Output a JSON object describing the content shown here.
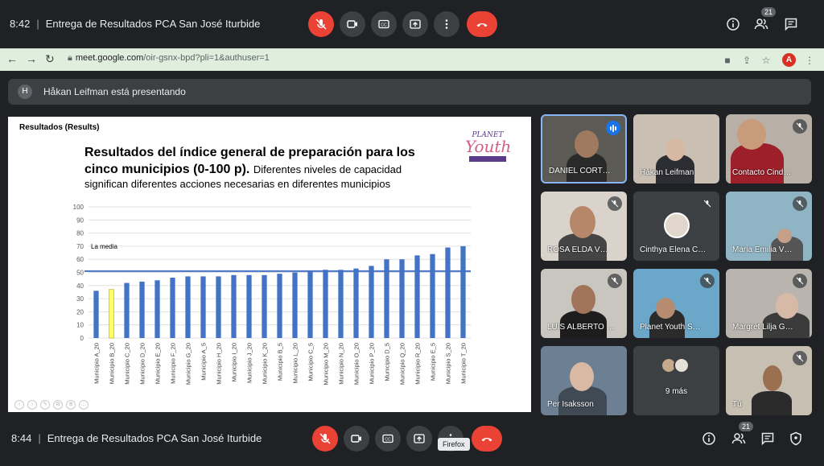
{
  "top_bar": {
    "time": "8:42",
    "separator": "|",
    "meeting_title": "Entrega de Resultados PCA San José Iturbide",
    "participant_count": "21"
  },
  "browser": {
    "url_domain": "meet.google.com",
    "url_path": "/oir-gsnx-bpd?pli=1&authuser=1",
    "profile_initial": "A"
  },
  "banner": {
    "initial": "H",
    "text": "Håkan Leifman está presentando"
  },
  "slide": {
    "label": "Resultados (Results)",
    "title": "Resultados del índice general de preparación para los cinco municipios (0-100 p).",
    "subtitle_inline": "Diferentes niveles de capacidad",
    "subtitle_line2": "significan diferentes acciones necesarias en diferentes municipios",
    "logo_planet": "PLANET",
    "logo_youth": "Youth",
    "mean_label": "La media"
  },
  "chart_data": {
    "type": "bar",
    "categories": [
      "Municipio A_20",
      "Municipio B_20",
      "Municipio C_20",
      "Municipio D_20",
      "Municipio E_20",
      "Municipio F_20",
      "Municipio G_20",
      "Municipio A_5",
      "Municipio H_20",
      "Municipio I_20",
      "Municipio J_20",
      "Municipio K_20",
      "Municipio B_5",
      "Municipio L_20",
      "Municipio C_5",
      "Municipio M_20",
      "Municipio N_20",
      "Municipio O_20",
      "Municipio P_20",
      "Municipio D_5",
      "Municipio Q_20",
      "Municipio R_20",
      "Municipio E_5",
      "Municipio S_20",
      "Municipio T_20"
    ],
    "values": [
      36,
      37,
      42,
      43,
      44,
      46,
      47,
      47,
      47,
      48,
      48,
      48,
      49,
      50,
      51,
      52,
      52,
      53,
      55,
      60,
      60,
      63,
      64,
      69,
      70
    ],
    "highlight_index": 1,
    "mean_value": 51,
    "ylim": [
      0,
      100
    ],
    "yticks": [
      0,
      10,
      20,
      30,
      40,
      50,
      60,
      70,
      80,
      90,
      100
    ],
    "bar_color": "#4472c4",
    "highlight_color": "#ffff66",
    "mean_line_color": "#4472c4"
  },
  "participants": [
    {
      "name": "DANIEL CORT…",
      "speaking": true
    },
    {
      "name": "Håkan Leifman",
      "muted": false
    },
    {
      "name": "Contacto Cind…",
      "muted": true
    },
    {
      "name": "ROSA ELDA V…",
      "muted": true
    },
    {
      "name": "Cinthya Elena C…",
      "muted": true
    },
    {
      "name": "Maria Emilia V…",
      "muted": true
    },
    {
      "name": "LUIS ALBERTO …",
      "muted": true
    },
    {
      "name": "Planet Youth S…",
      "muted": true
    },
    {
      "name": "Margrét Lilja G…",
      "muted": true
    },
    {
      "name": "Per Isaksson",
      "muted": false
    },
    {
      "name": "9 más",
      "muted": false
    },
    {
      "name": "Tú",
      "muted": true
    }
  ],
  "bottom_bar": {
    "time": "8:44",
    "separator": "|",
    "meeting_title": "Entrega de Resultados PCA San José Iturbide",
    "participant_count": "21",
    "tooltip": "Firefox"
  },
  "colors": {
    "bg": "#202124",
    "red": "#ea4335",
    "control": "#3c4043"
  }
}
